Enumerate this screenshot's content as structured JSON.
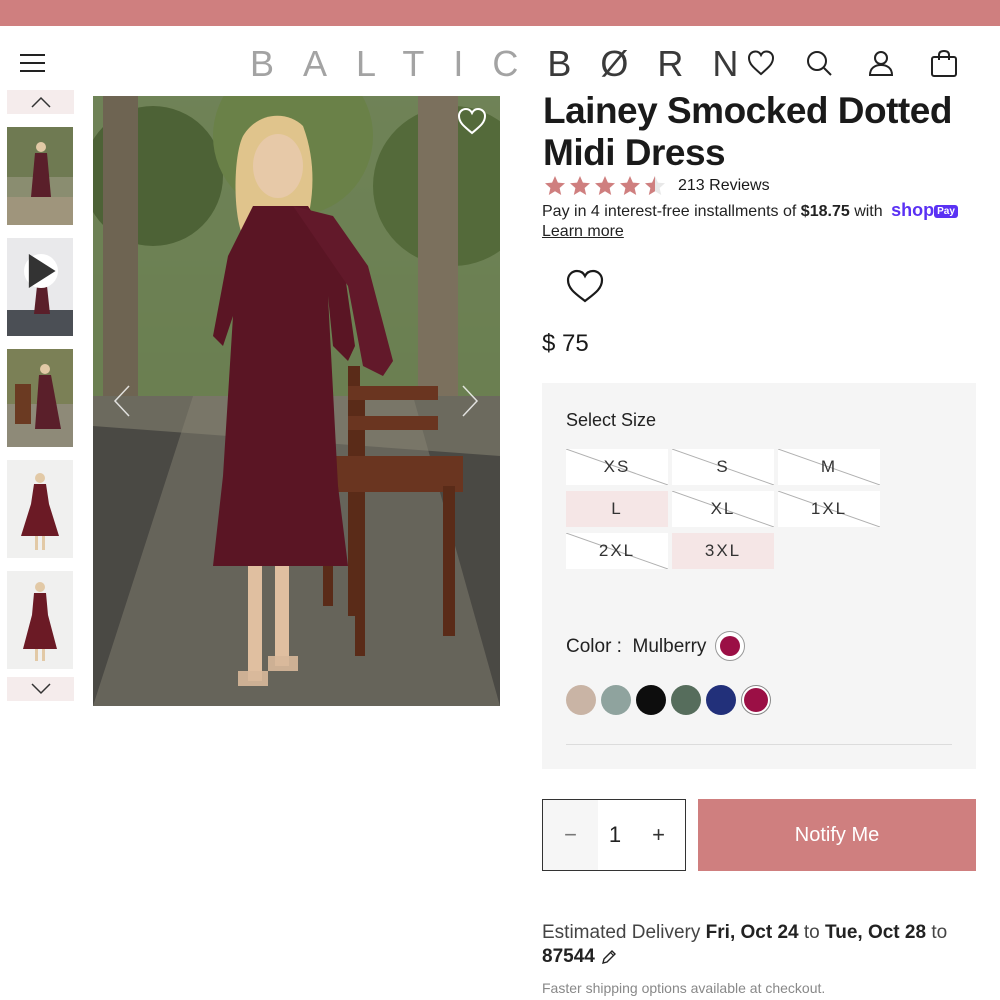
{
  "brand": {
    "logo_light": "BALTIC",
    "logo_dark": "BØRN"
  },
  "header": {
    "icons": [
      "menu-icon",
      "heart-icon",
      "search-icon",
      "account-icon",
      "bag-icon"
    ]
  },
  "gallery": {
    "thumbnails": [
      "dress-standing-front",
      "video-dress",
      "dress-with-chair",
      "dress-front-full",
      "dress-front-full-2"
    ],
    "thumbnail_icons": [
      "play-icon"
    ]
  },
  "product": {
    "title": "Lainey Smocked Dotted Midi Dress",
    "rating": 4.5,
    "review_count": "213 Reviews",
    "installment_prefix": "Pay in 4 interest-free installments of",
    "installment_amount": "$18.75",
    "installment_suffix": "with",
    "shop_pay_brand": "shop",
    "shop_pay_badge": "Pay",
    "learn_more": "Learn more",
    "price": "$ 75"
  },
  "options": {
    "select_size_label": "Select Size",
    "sizes": [
      {
        "label": "XS",
        "available": false
      },
      {
        "label": "S",
        "available": false
      },
      {
        "label": "M",
        "available": false
      },
      {
        "label": "L",
        "available": true
      },
      {
        "label": "XL",
        "available": false
      },
      {
        "label": "1XL",
        "available": false
      },
      {
        "label": "2XL",
        "available": false
      },
      {
        "label": "3XL",
        "available": true
      }
    ],
    "color_label": "Color :",
    "color_value": "Mulberry",
    "swatches": [
      {
        "name": "tan",
        "hex": "#c9b4a5"
      },
      {
        "name": "sage",
        "hex": "#8fa39e"
      },
      {
        "name": "black",
        "hex": "#0d0d0d"
      },
      {
        "name": "green",
        "hex": "#566d5c"
      },
      {
        "name": "navy",
        "hex": "#22307a"
      },
      {
        "name": "mulberry",
        "hex": "#9b0f45",
        "selected": true
      }
    ]
  },
  "cart": {
    "qty_minus": "−",
    "quantity": "1",
    "qty_plus": "+",
    "notify_label": "Notify Me"
  },
  "delivery": {
    "prefix": "Estimated Delivery",
    "from": "Fri, Oct 24",
    "to_word": "to",
    "until": "Tue, Oct 28",
    "to_word_2": "to",
    "zip": "87544",
    "note": "Faster shipping options available at checkout."
  },
  "colors": {
    "accent": "#cf7f7f",
    "star": "#cf7f7f",
    "panel_bg": "#f5f5f5",
    "size_available_bg": "#f5e6e6"
  }
}
